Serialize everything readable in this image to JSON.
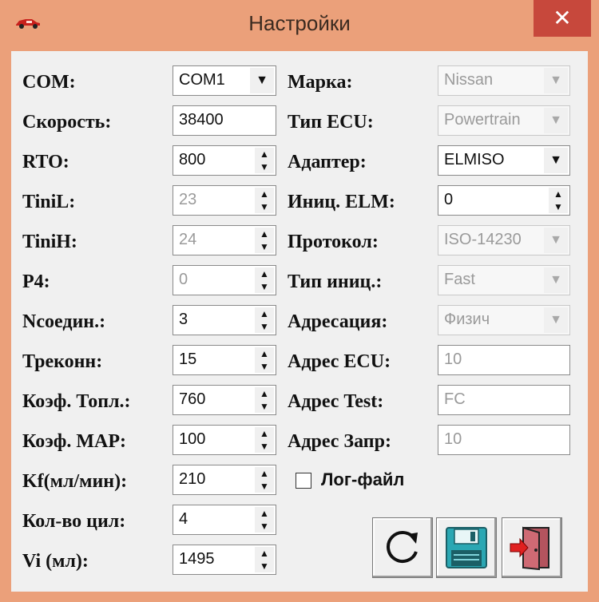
{
  "window": {
    "title": "Настройки",
    "close_label": "✕",
    "app_icon": "car-icon"
  },
  "left_fields": [
    {
      "label": "COM:",
      "value": "COM1",
      "kind": "combo",
      "enabled": true
    },
    {
      "label": "Скорость:",
      "value": "38400",
      "kind": "edit",
      "enabled": true
    },
    {
      "label": "RTO:",
      "value": "800",
      "kind": "spin",
      "enabled": true
    },
    {
      "label": "TiniL:",
      "value": "23",
      "kind": "spin",
      "enabled": false
    },
    {
      "label": "TiniH:",
      "value": "24",
      "kind": "spin",
      "enabled": false
    },
    {
      "label": "P4:",
      "value": "0",
      "kind": "spin",
      "enabled": false
    },
    {
      "label": "Nсоедин.:",
      "value": "3",
      "kind": "spin",
      "enabled": true
    },
    {
      "label": "Треконн:",
      "value": "15",
      "kind": "spin",
      "enabled": true
    },
    {
      "label": "Коэф. Топл.:",
      "value": "760",
      "kind": "spin",
      "enabled": true
    },
    {
      "label": "Коэф. MAP:",
      "value": "100",
      "kind": "spin",
      "enabled": true
    },
    {
      "label": "Kf(мл/мин):",
      "value": "210",
      "kind": "spin",
      "enabled": true
    },
    {
      "label": "Кол-во цил:",
      "value": "4",
      "kind": "spin",
      "enabled": true
    },
    {
      "label": "Vi (мл):",
      "value": "1495",
      "kind": "spin",
      "enabled": true
    }
  ],
  "right_fields": [
    {
      "label": "Марка:",
      "value": "Nissan",
      "kind": "combo",
      "enabled": false
    },
    {
      "label": "Тип ECU:",
      "value": "Powertrain",
      "kind": "combo",
      "enabled": false
    },
    {
      "label": "Адаптер:",
      "value": "ELMISO",
      "kind": "combo",
      "enabled": true
    },
    {
      "label": "Иниц. ELM:",
      "value": "0",
      "kind": "spin",
      "enabled": true
    },
    {
      "label": "Протокол:",
      "value": "ISO-14230",
      "kind": "combo",
      "enabled": false
    },
    {
      "label": "Тип иниц.:",
      "value": "Fast",
      "kind": "combo",
      "enabled": false
    },
    {
      "label": "Адресация:",
      "value": "Физич",
      "kind": "combo",
      "enabled": false
    },
    {
      "label": "Адрес ECU:",
      "value": "10",
      "kind": "edit",
      "enabled": false
    },
    {
      "label": "Адрес Test:",
      "value": "FC",
      "kind": "edit",
      "enabled": false
    },
    {
      "label": "Адрес Запр:",
      "value": "10",
      "kind": "edit",
      "enabled": false
    }
  ],
  "log_checkbox": {
    "label": "Лог-файл",
    "checked": false
  },
  "toolbar": [
    {
      "name": "refresh-button",
      "icon": "refresh-icon"
    },
    {
      "name": "save-button",
      "icon": "floppy-disk-icon"
    },
    {
      "name": "exit-button",
      "icon": "exit-door-icon"
    }
  ],
  "colors": {
    "frame": "#eba07a",
    "close": "#c7483c",
    "client": "#f0f0f0",
    "floppy": "#2aa7b3",
    "door": "#b4545e"
  }
}
